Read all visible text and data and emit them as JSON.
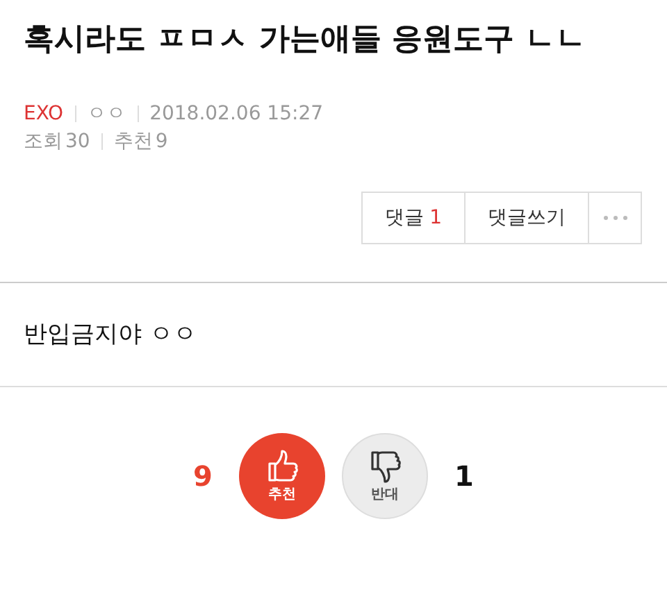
{
  "post": {
    "title": "혹시라도 ㅍㅁㅅ 가는애들 응원도구 ㄴㄴ",
    "board": "EXO",
    "author": "ㅇㅇ",
    "date": "2018.02.06 15:27",
    "views_label": "조회",
    "views": "30",
    "recommend_label": "추천",
    "recommend": "9"
  },
  "actions": {
    "comments_label": "댓글",
    "comments_count": "1",
    "write_comment": "댓글쓰기"
  },
  "body": "반입금지야 ㅇㅇ",
  "votes": [
    {
      "kind": "up",
      "count": "9",
      "label": "추천",
      "selected": true
    },
    {
      "kind": "down",
      "count": "1",
      "label": "반대",
      "selected": false
    }
  ]
}
